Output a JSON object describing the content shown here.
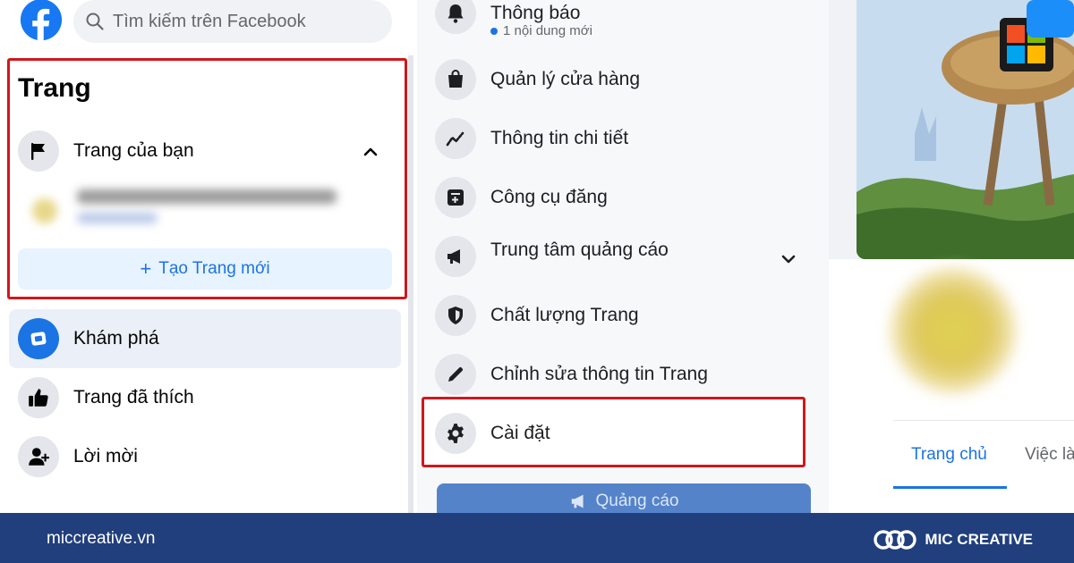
{
  "search": {
    "placeholder": "Tìm kiếm trên Facebook"
  },
  "pages_section": {
    "title": "Trang",
    "your_pages_label": "Trang của bạn",
    "create_label": "Tạo Trang mới"
  },
  "nav": [
    {
      "label": "Khám phá",
      "icon": "explore-icon"
    },
    {
      "label": "Trang đã thích",
      "icon": "thumbs-up-icon"
    },
    {
      "label": "Lời mời",
      "icon": "add-person-icon"
    }
  ],
  "manage_menu": {
    "notifications": {
      "label": "Thông báo",
      "sub": "1 nội dung mới"
    },
    "items": [
      {
        "label": "Quản lý cửa hàng",
        "icon": "shopping-bag-icon"
      },
      {
        "label": "Thông tin chi tiết",
        "icon": "trend-icon"
      },
      {
        "label": "Công cụ đăng",
        "icon": "publishing-tools-icon"
      },
      {
        "label": "Trung tâm quảng cáo",
        "icon": "megaphone-icon"
      },
      {
        "label": "Chất lượng Trang",
        "icon": "shield-icon"
      },
      {
        "label": "Chỉnh sửa thông tin Trang",
        "icon": "pencil-icon"
      },
      {
        "label": "Cài đặt",
        "icon": "gear-icon"
      }
    ],
    "ads_button": "Quảng cáo"
  },
  "page_tabs": {
    "home": "Trang chủ",
    "jobs": "Việc là"
  },
  "footer": {
    "url": "miccreative.vn",
    "brand": "MIC CREATIVE"
  },
  "colors": {
    "facebook_blue": "#1b74e4",
    "highlight_red": "#d0171c",
    "footer_bg": "#203f7c"
  }
}
